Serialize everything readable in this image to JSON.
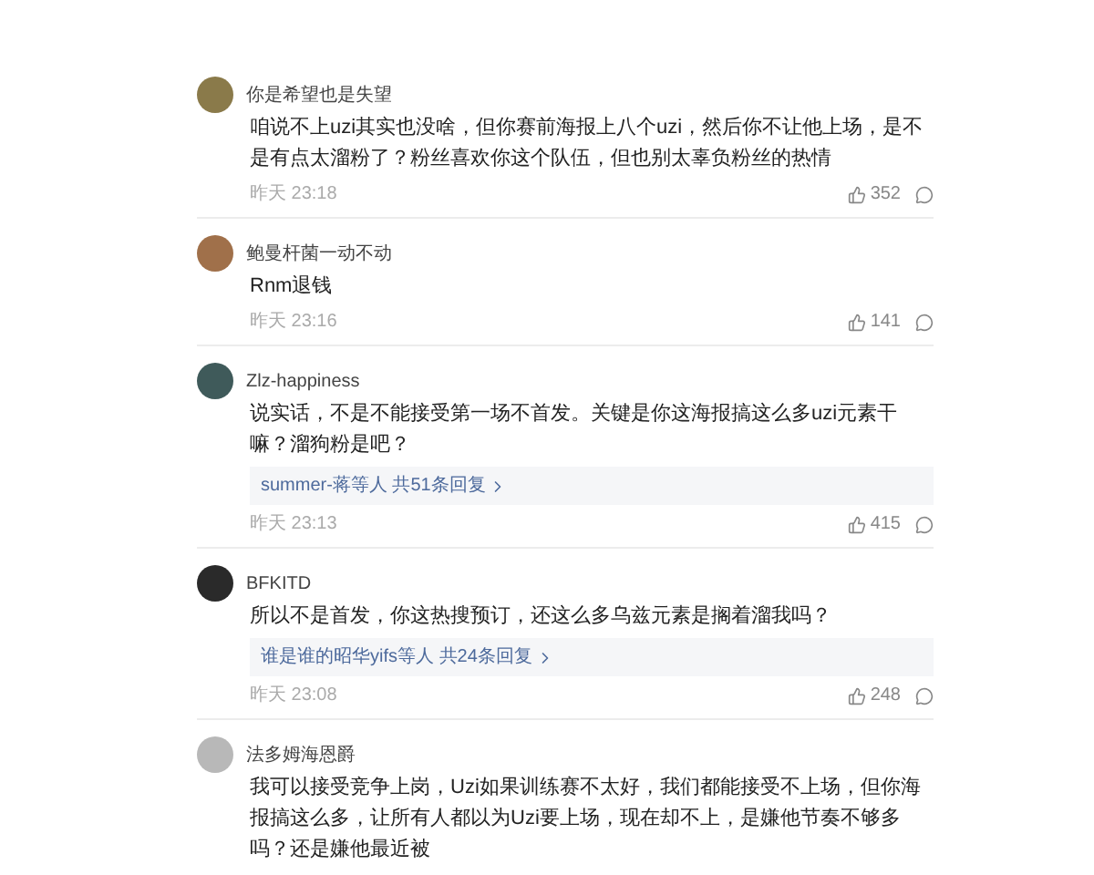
{
  "comments": [
    {
      "user": "你是希望也是失望",
      "body": "咱说不上uzi其实也没啥，但你赛前海报上八个uzi，然后你不让他上场，是不是有点太溜粉了？粉丝喜欢你这个队伍，但也别太辜负粉丝的热情",
      "time": "昨天 23:18",
      "likes": "352"
    },
    {
      "user": "鲍曼杆菌一动不动",
      "body": "Rnm退钱",
      "time": "昨天 23:16",
      "likes": "141"
    },
    {
      "user": "Zlz-happiness",
      "body": "说实话，不是不能接受第一场不首发。关键是你这海报搞这么多uzi元素干嘛？溜狗粉是吧？",
      "replies": "summer-蒋等人 共51条回复",
      "time": "昨天 23:13",
      "likes": "415"
    },
    {
      "user": "BFKITD",
      "body": "所以不是首发，你这热搜预订，还这么多乌兹元素是搁着溜我吗？",
      "replies": "谁是谁的昭华yifs等人 共24条回复",
      "time": "昨天 23:08",
      "likes": "248"
    },
    {
      "user": "法多姆海恩爵",
      "body": "我可以接受竞争上岗，Uzi如果训练赛不太好，我们都能接受不上场，但你海报搞这么多，让所有人都以为Uzi要上场，现在却不上，是嫌他节奏不够多吗？还是嫌他最近被"
    }
  ]
}
